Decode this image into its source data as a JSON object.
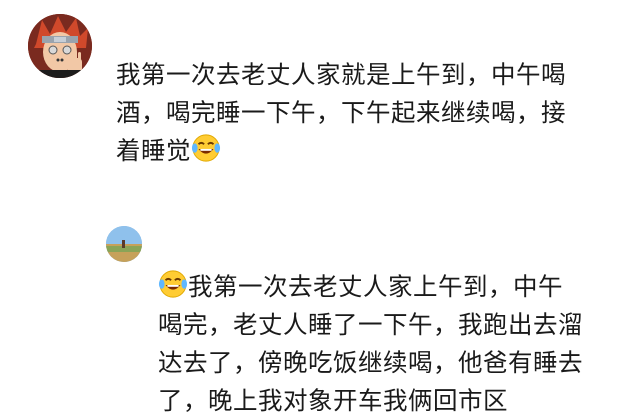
{
  "comments": [
    {
      "lines": [
        "我第一次去老丈人家就是上午到，中午喝",
        "酒，喝完睡一下午，下午起来继续喝，接",
        "着睡觉"
      ],
      "emoji_after": "laughing-crying-face"
    },
    {
      "emoji_before": "laughing-crying-face",
      "lines": [
        "我第一次去老丈人家上午到，中午",
        "喝完，老丈人睡了一下午，我跑出去溜",
        "达去了，傍晚吃饭继续喝，他爸有睡去",
        "了，晚上我对象开车我俩回市区"
      ]
    }
  ]
}
